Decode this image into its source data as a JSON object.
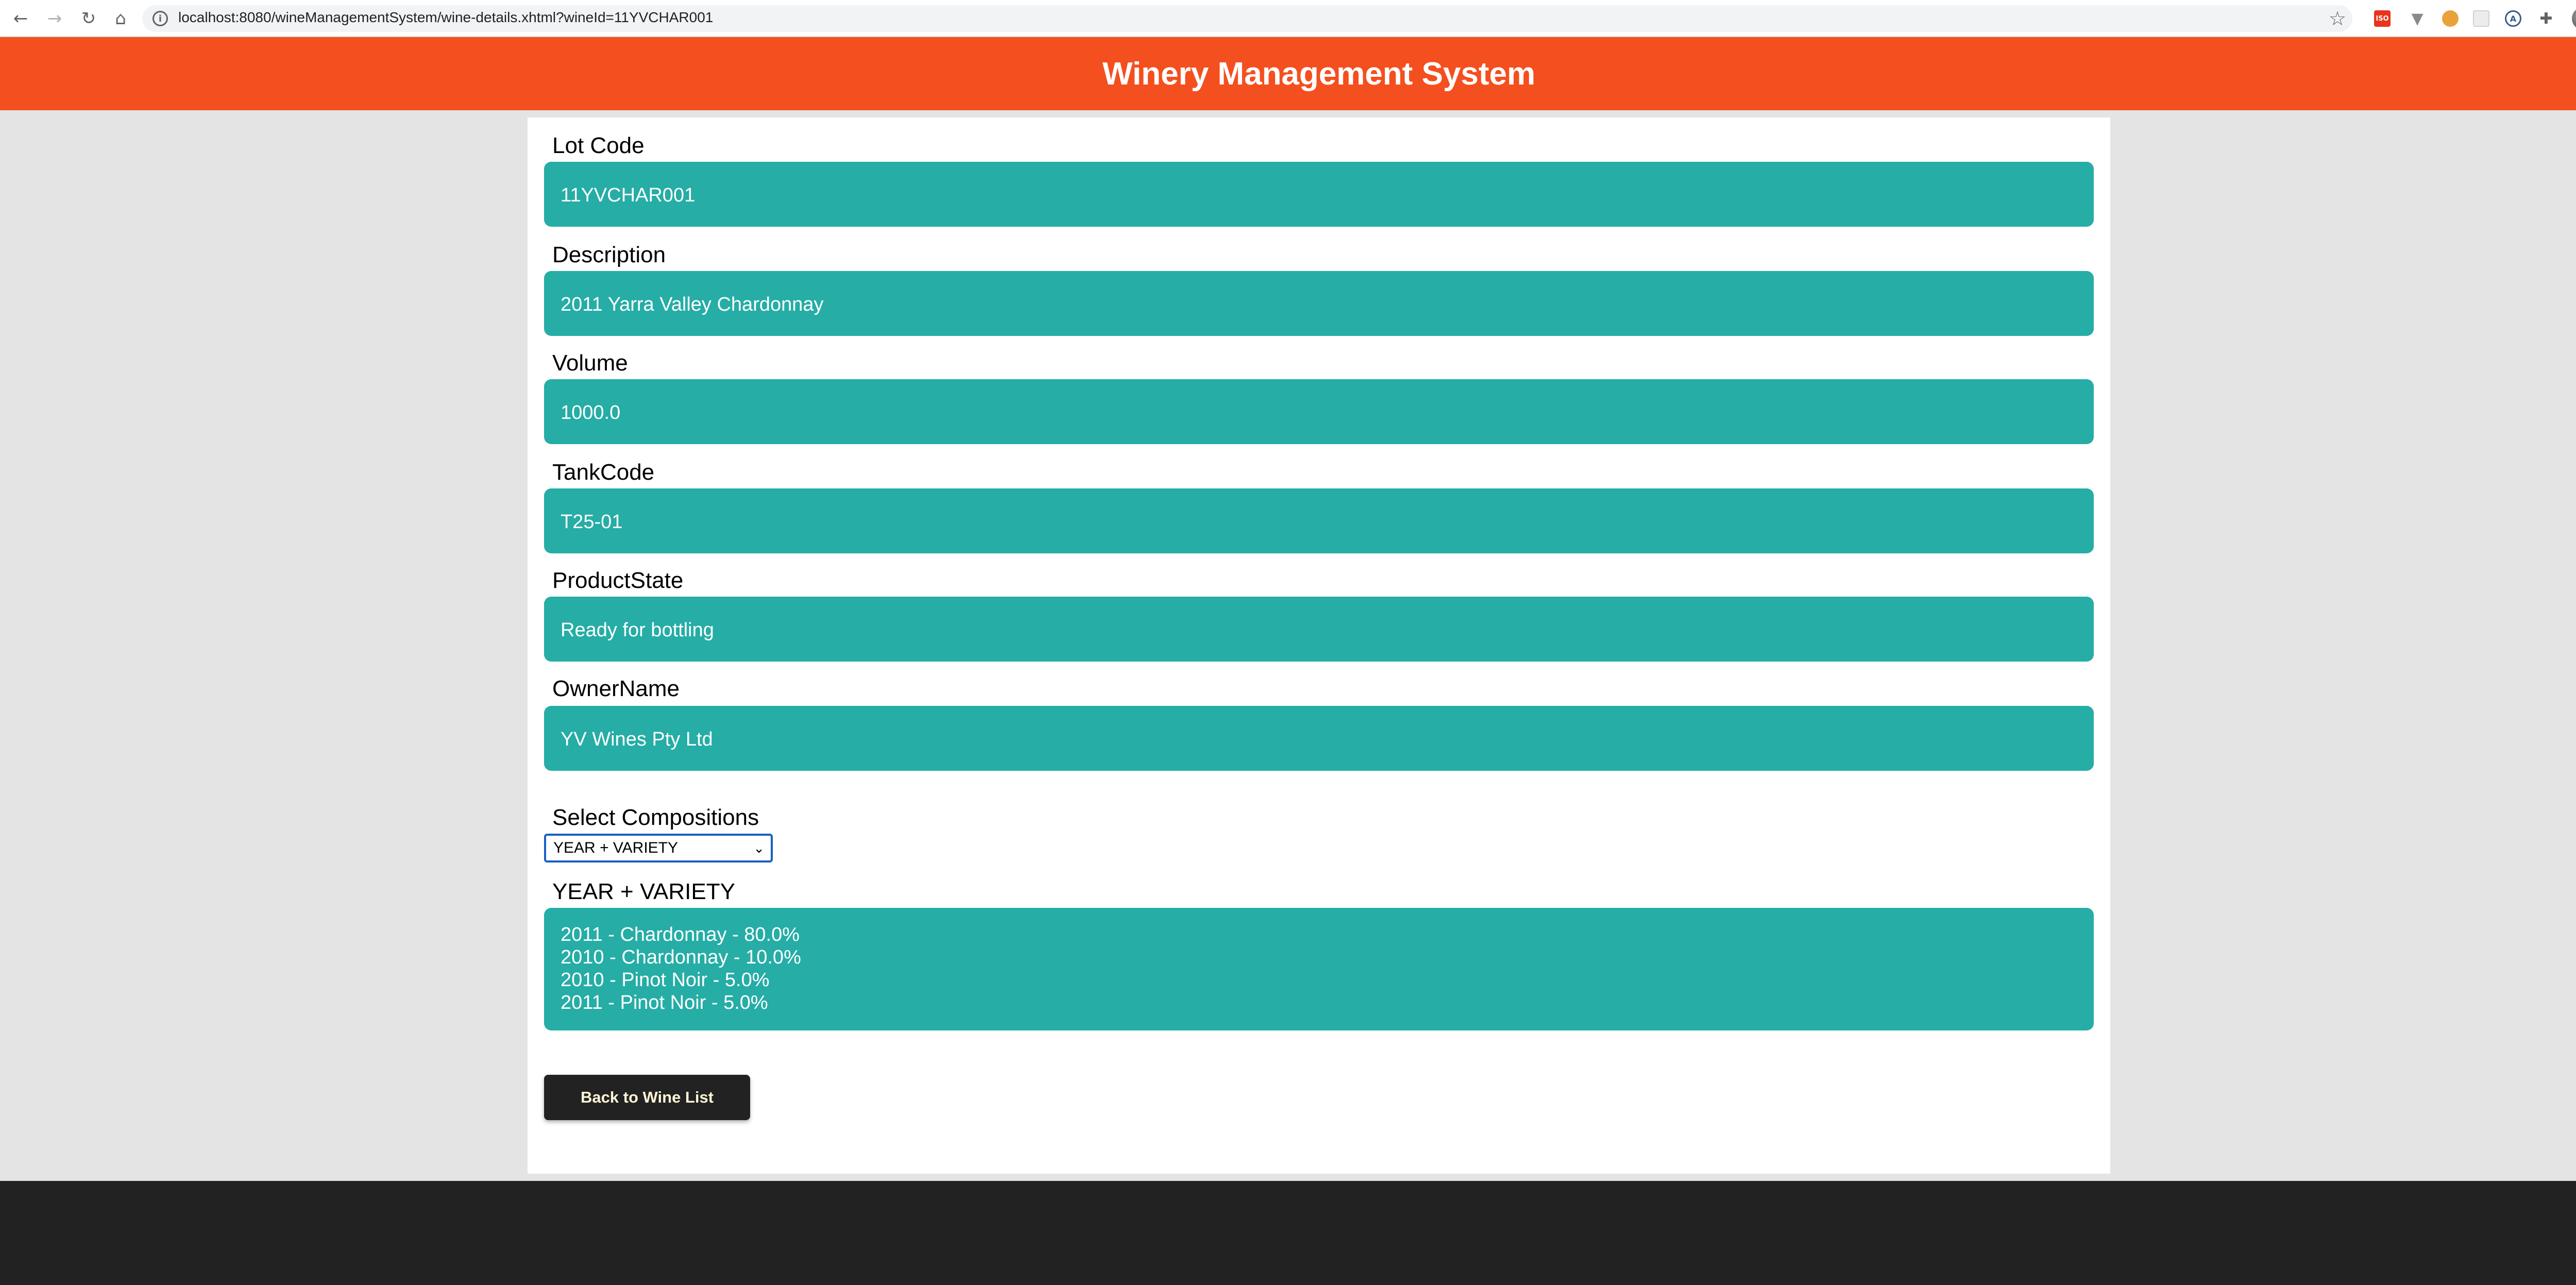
{
  "browser": {
    "url": "localhost:8080/wineManagementSystem/wine-details.xhtml?wineId=11YVCHAR001",
    "nav_icons": [
      "back-arrow-icon",
      "forward-arrow-icon",
      "reload-icon",
      "home-icon"
    ],
    "extensions": [
      "bookmark-star-icon",
      "extension-red-icon",
      "extension-v-icon",
      "extension-cookie-icon",
      "extension-blank-icon",
      "extension-a-icon",
      "puzzle-icon",
      "avatar",
      "menu-dots-icon"
    ]
  },
  "app": {
    "title": "Winery Management System",
    "header_color": "#f44f1e",
    "field_color": "#25ada6"
  },
  "fields": [
    {
      "label": "Lot Code",
      "value": "11YVCHAR001"
    },
    {
      "label": "Description",
      "value": "2011 Yarra Valley Chardonnay"
    },
    {
      "label": "Volume",
      "value": "1000.0"
    },
    {
      "label": "TankCode",
      "value": "T25-01"
    },
    {
      "label": "ProductState",
      "value": "Ready for bottling"
    },
    {
      "label": "OwnerName",
      "value": "YV Wines Pty Ltd"
    }
  ],
  "compositions": {
    "select_label": "Select Compositions",
    "selected_option": "YEAR + VARIETY",
    "heading": "YEAR + VARIETY",
    "lines": [
      "2011 - Chardonnay - 80.0%",
      "2010 - Chardonnay - 10.0%",
      "2010 - Pinot Noir - 5.0%",
      "2011 - Pinot Noir - 5.0%"
    ]
  },
  "actions": {
    "back_label": "Back to Wine List"
  }
}
